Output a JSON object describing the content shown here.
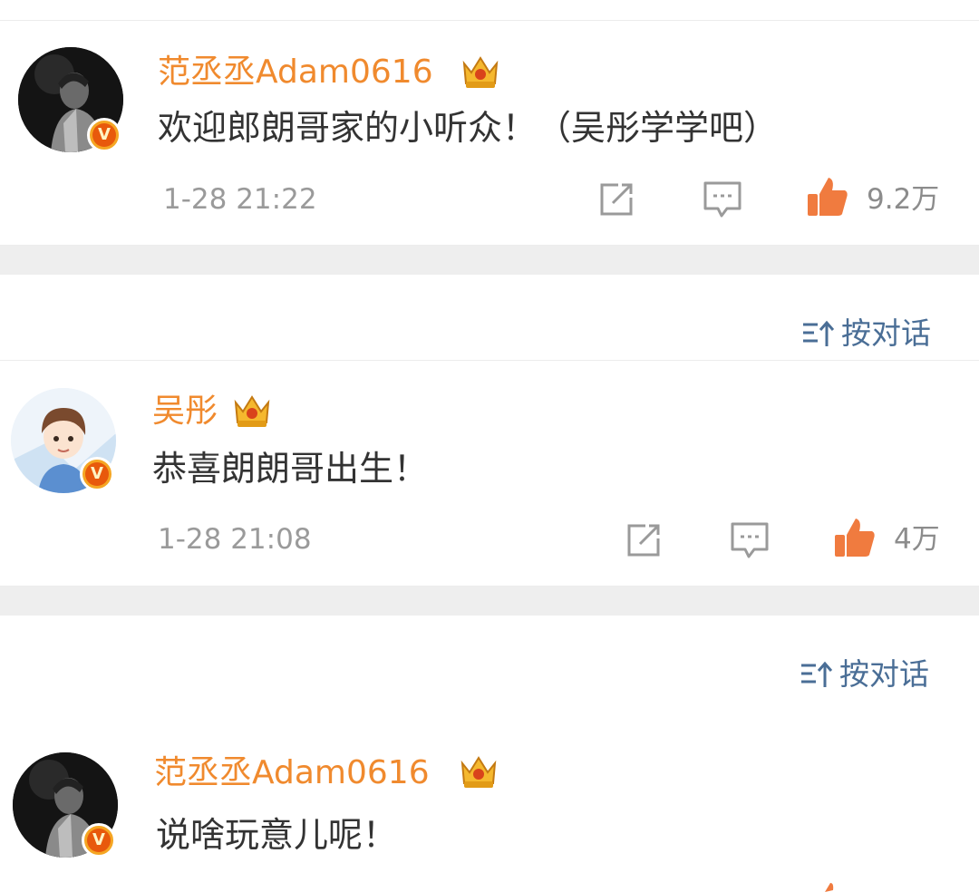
{
  "comments": [
    {
      "username": "范丞丞Adam0616",
      "text": "欢迎郎朗哥家的小听众！（吴彤学学吧）",
      "time": "1-28 21:22",
      "likes": "9.2万",
      "verified_badge": "V"
    },
    {
      "username": "吴彤",
      "text": "恭喜朗朗哥出生！",
      "time": "1-28 21:08",
      "likes": "4万",
      "verified_badge": "V"
    },
    {
      "username": "范丞丞Adam0616",
      "text": "说啥玩意儿呢！",
      "verified_badge": "V"
    }
  ],
  "sort_labels": [
    "按对话",
    "按对话"
  ],
  "icons": [
    "crown-icon",
    "share-icon",
    "comment-icon",
    "like-icon",
    "sort-icon",
    "verified-icon"
  ],
  "colors": {
    "username": "#f08a2e",
    "like": "#f07b3f",
    "link": "#4a6e96",
    "separator": "#eeeeee",
    "badge": "#e8590c"
  }
}
